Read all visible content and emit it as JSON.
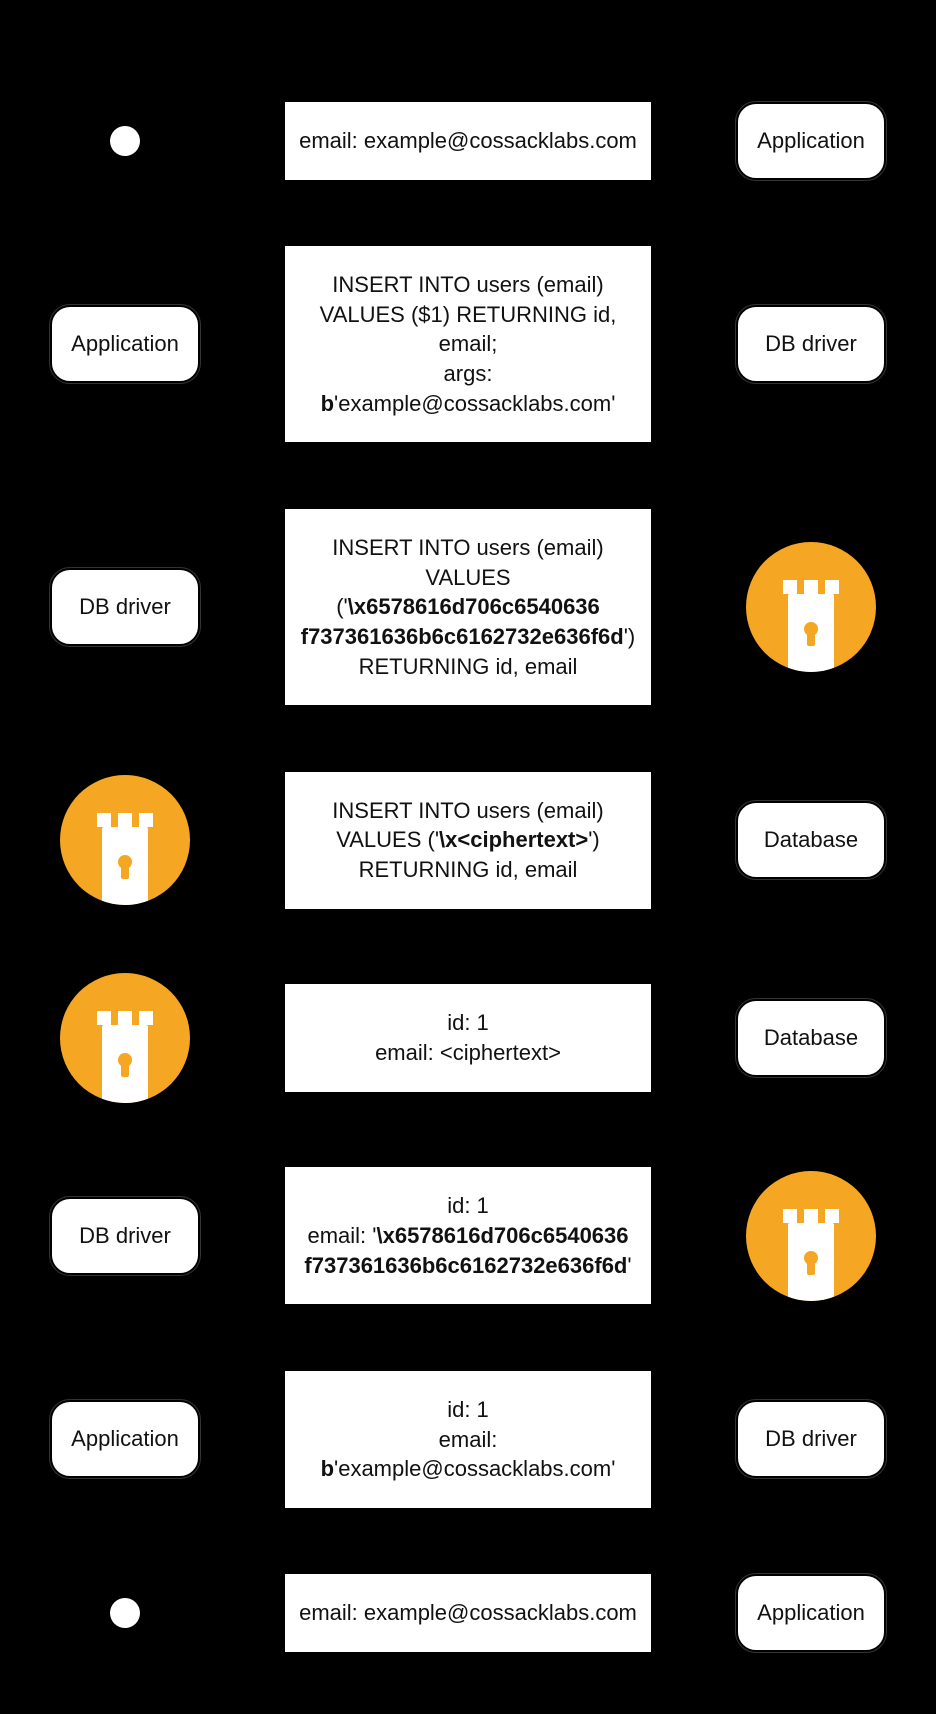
{
  "labels": {
    "application": "Application",
    "db_driver": "DB driver",
    "database": "Database"
  },
  "rows": [
    {
      "left": {
        "type": "user"
      },
      "center": {
        "lines": [
          "email: example@cossacklabs.com"
        ]
      },
      "right": {
        "type": "box",
        "labelKey": "application"
      }
    },
    {
      "left": {
        "type": "box",
        "labelKey": "application"
      },
      "center": {
        "lines": [
          "INSERT INTO users (email)",
          "VALUES ($1) RETURNING id, email;",
          "args: |b|'example@cossacklabs.com'"
        ]
      },
      "right": {
        "type": "box",
        "labelKey": "db_driver"
      }
    },
    {
      "left": {
        "type": "box",
        "labelKey": "db_driver"
      },
      "center": {
        "lines": [
          "INSERT INTO users (email)",
          "VALUES ('|\\x6578616d706c6540636|",
          "|f737361636b6c6162732e636f6d|')",
          "RETURNING id, email"
        ]
      },
      "right": {
        "type": "tower"
      }
    },
    {
      "left": {
        "type": "tower"
      },
      "center": {
        "lines": [
          "INSERT INTO users (email)",
          "VALUES ('|\\x<ciphertext>|')",
          "RETURNING id, email"
        ]
      },
      "right": {
        "type": "box",
        "labelKey": "database"
      }
    },
    {
      "left": {
        "type": "tower"
      },
      "center": {
        "lines": [
          "id: 1",
          "email: <ciphertext>"
        ]
      },
      "right": {
        "type": "box",
        "labelKey": "database"
      }
    },
    {
      "left": {
        "type": "box",
        "labelKey": "db_driver"
      },
      "center": {
        "lines": [
          "id: 1",
          "email:  '|\\x6578616d706c6540636|",
          "|f737361636b6c6162732e636f6d|'"
        ]
      },
      "right": {
        "type": "tower"
      }
    },
    {
      "left": {
        "type": "box",
        "labelKey": "application"
      },
      "center": {
        "lines": [
          "id: 1",
          "email: |b|'example@cossacklabs.com'"
        ]
      },
      "right": {
        "type": "box",
        "labelKey": "db_driver"
      }
    },
    {
      "left": {
        "type": "user"
      },
      "center": {
        "lines": [
          "email: example@cossacklabs.com"
        ]
      },
      "right": {
        "type": "box",
        "labelKey": "application"
      }
    }
  ]
}
